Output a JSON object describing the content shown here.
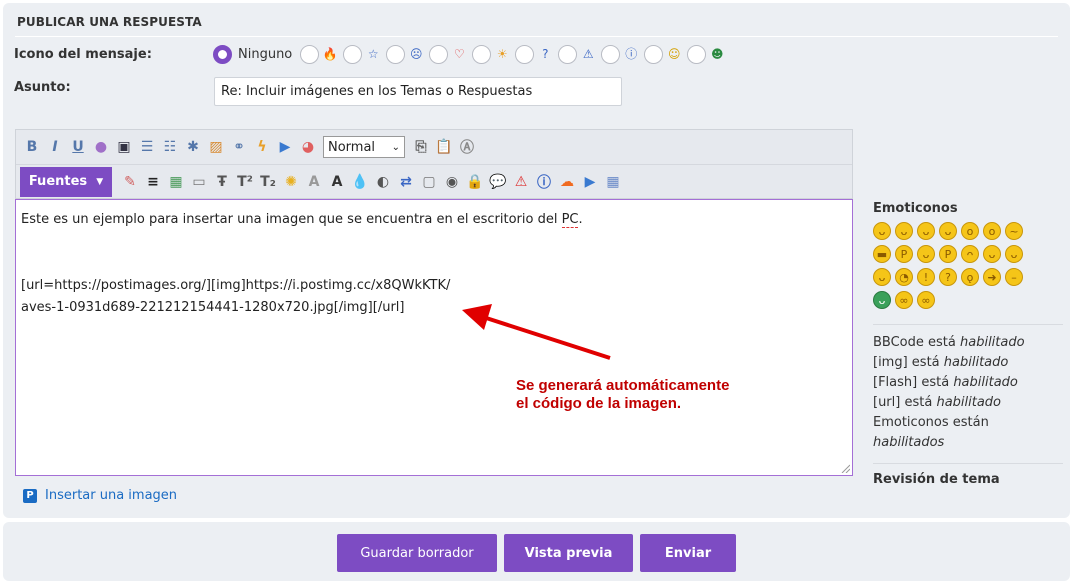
{
  "panel": {
    "title": "PUBLICAR UNA RESPUESTA"
  },
  "icon_row": {
    "label": "Icono del mensaje:",
    "none_label": "Ninguno",
    "options": [
      "🔥",
      "☆",
      "☹",
      "♡",
      "☀",
      "?",
      "⚠",
      "ⓘ",
      "☺",
      "☻"
    ]
  },
  "subject": {
    "label": "Asunto:",
    "value": "Re: Incluir imágenes en los Temas o Respuestas"
  },
  "toolbar": {
    "size_select": "Normal",
    "fonts_button": "Fuentes"
  },
  "editor": {
    "line1_pre": "Este es un ejemplo para insertar una imagen que se encuentra en el escritorio del ",
    "line1_misspelled": "PC",
    "line1_post": ".",
    "line2": "[url=https://postimages.org/][img]https://i.postimg.cc/x8QWkKTK/",
    "line3": "aves-1-0931d689-221212154441-1280x720.jpg[/img][/url]"
  },
  "annotation": {
    "line1": "Se generará automáticamente",
    "line2": "el código de la imagen.",
    "color": "#c00000"
  },
  "insert_image": {
    "label": "Insertar una imagen",
    "icon": "postimages-icon"
  },
  "sidebar": {
    "emoticons_heading": "Emoticonos",
    "status": {
      "bbcode_pre": "BBCode está ",
      "bbcode_state": "habilitado",
      "img_pre": "[img] está ",
      "img_state": "habilitado",
      "flash_pre": "[Flash] está ",
      "flash_state": "habilitado",
      "url_pre": "[url] está ",
      "url_state": "habilitado",
      "emo_pre": "Emoticonos están ",
      "emo_state": "habilitados"
    },
    "topic_review": "Revisión de tema"
  },
  "buttons": {
    "save_draft": "Guardar borrador",
    "preview": "Vista previa",
    "submit": "Enviar"
  },
  "colors": {
    "accent": "#7d4cc3",
    "link": "#1a6bc3",
    "panel_bg": "#eceff3"
  }
}
